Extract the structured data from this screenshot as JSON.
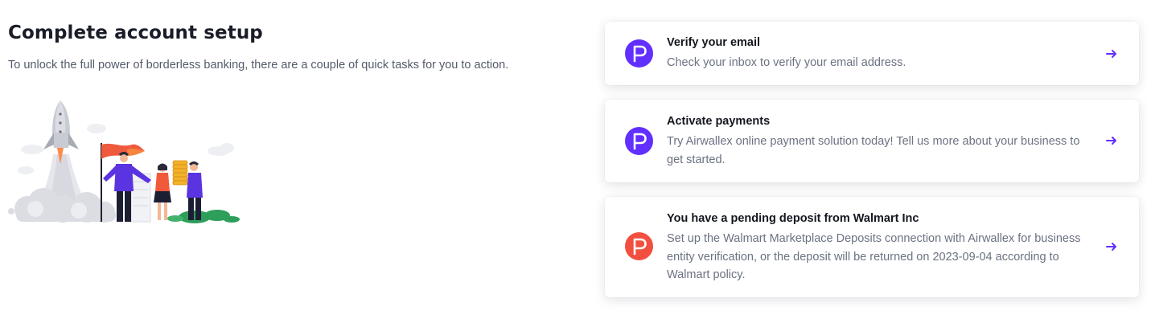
{
  "setup": {
    "title": "Complete account setup",
    "subtitle": "To unlock the full power of borderless banking, there are a couple of quick tasks for you to action."
  },
  "illustration": {
    "icon": "rocket-team-illustration"
  },
  "colors": {
    "accent": "#612fff",
    "alert": "#f24f40",
    "text_primary": "#14171f",
    "text_secondary": "#6b7282"
  },
  "tasks": [
    {
      "title": "Verify your email",
      "description": "Check your inbox to verify your email address.",
      "icon": "flag-icon",
      "icon_color": "#612fff",
      "action_icon": "arrow-right-icon"
    },
    {
      "title": "Activate payments",
      "description": "Try Airwallex online payment solution today! Tell us more about your business to get started.",
      "icon": "flag-icon",
      "icon_color": "#612fff",
      "action_icon": "arrow-right-icon"
    },
    {
      "title": "You have a pending deposit from Walmart Inc",
      "description": "Set up the Walmart Marketplace Deposits connection with Airwallex for business entity verification, or the deposit will be returned on 2023-09-04 according to Walmart policy.",
      "icon": "flag-icon",
      "icon_color": "#f24f40",
      "action_icon": "arrow-right-icon"
    }
  ]
}
